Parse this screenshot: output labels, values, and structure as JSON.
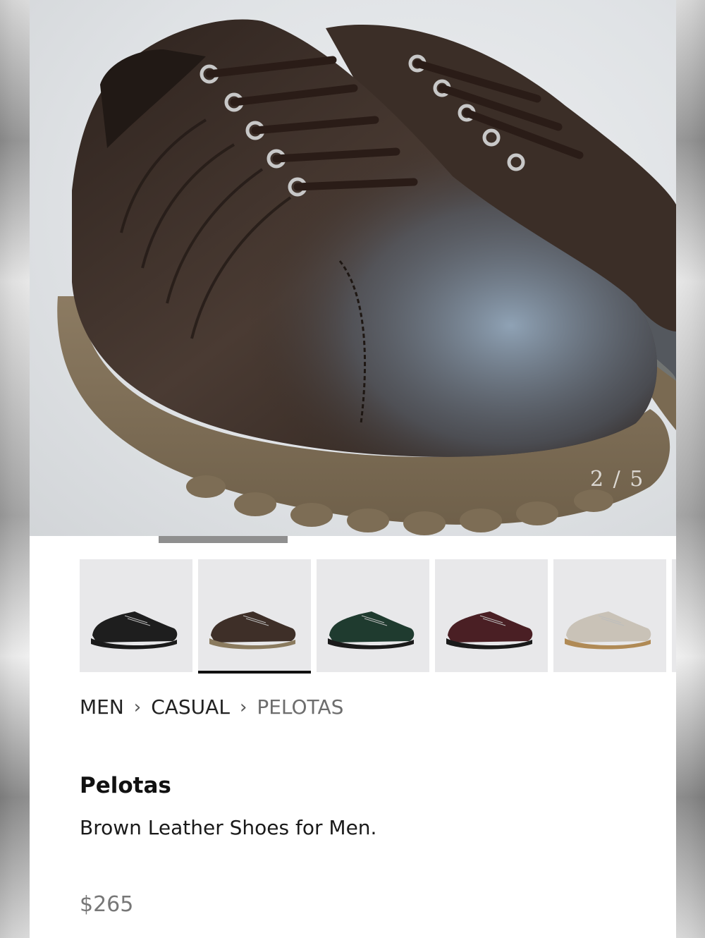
{
  "gallery": {
    "counter": "2 / 5",
    "current_index": 2,
    "total_images": 5,
    "progress_fraction": 0.2
  },
  "thumbnails": [
    {
      "name": "black shoe",
      "color": "#1e1e1e",
      "sole": "#1a1a1a",
      "active": false
    },
    {
      "name": "brown shoe",
      "color": "#3e2f28",
      "sole": "#8a7a5e",
      "active": true
    },
    {
      "name": "green shoe",
      "color": "#1f3b2f",
      "sole": "#1a1a1a",
      "active": false
    },
    {
      "name": "burgundy shoe",
      "color": "#4a1f24",
      "sole": "#1a1a1a",
      "active": false
    },
    {
      "name": "silver shoe",
      "color": "#c9c2b7",
      "sole": "#b08a55",
      "active": false
    }
  ],
  "breadcrumb": {
    "items": [
      "MEN",
      "CASUAL",
      "PELOTAS"
    ],
    "separator": "›"
  },
  "product": {
    "name": "Pelotas",
    "description": "Brown Leather Shoes for Men.",
    "price": "$265"
  },
  "colors": {
    "progress": "#8f8f8f",
    "active_underline": "#111111"
  }
}
